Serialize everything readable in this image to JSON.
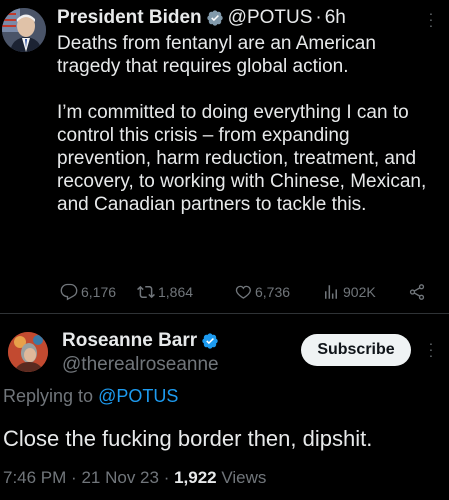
{
  "tweet": {
    "author_name": "President Biden",
    "author_handle": "@POTUS",
    "separator": "·",
    "time": "6h",
    "paragraph1": "Deaths from fentanyl are an American tragedy that requires global action.",
    "paragraph2": "I’m committed to doing everything I can to control this crisis – from expanding prevention, harm reduction, treatment, and recovery, to working with Chinese, Mexican, and Canadian partners to tackle this.",
    "replies": "6,176",
    "retweets": "1,864",
    "likes": "6,736",
    "views": "902K",
    "icons": [
      "reply-icon",
      "retweet-icon",
      "like-icon",
      "views-icon",
      "share-icon",
      "verified-badge-icon",
      "more-icon"
    ]
  },
  "reply": {
    "author_name": "Roseanne Barr",
    "author_handle": "@therealroseanne",
    "subscribe_label": "Subscribe",
    "replying_prefix": "Replying to",
    "replying_mention": "@POTUS",
    "text": "Close the fucking border then, dipshit.",
    "time": "7:46 PM",
    "separator": "·",
    "date": "21 Nov 23",
    "views_count": "1,922",
    "views_label": "Views"
  },
  "colors": {
    "background": "#000000",
    "text": "#e7e9ea",
    "muted": "#71767b",
    "link": "#1d9bf0",
    "verified": "#1d9bf0",
    "button_bg": "#eff3f4"
  }
}
